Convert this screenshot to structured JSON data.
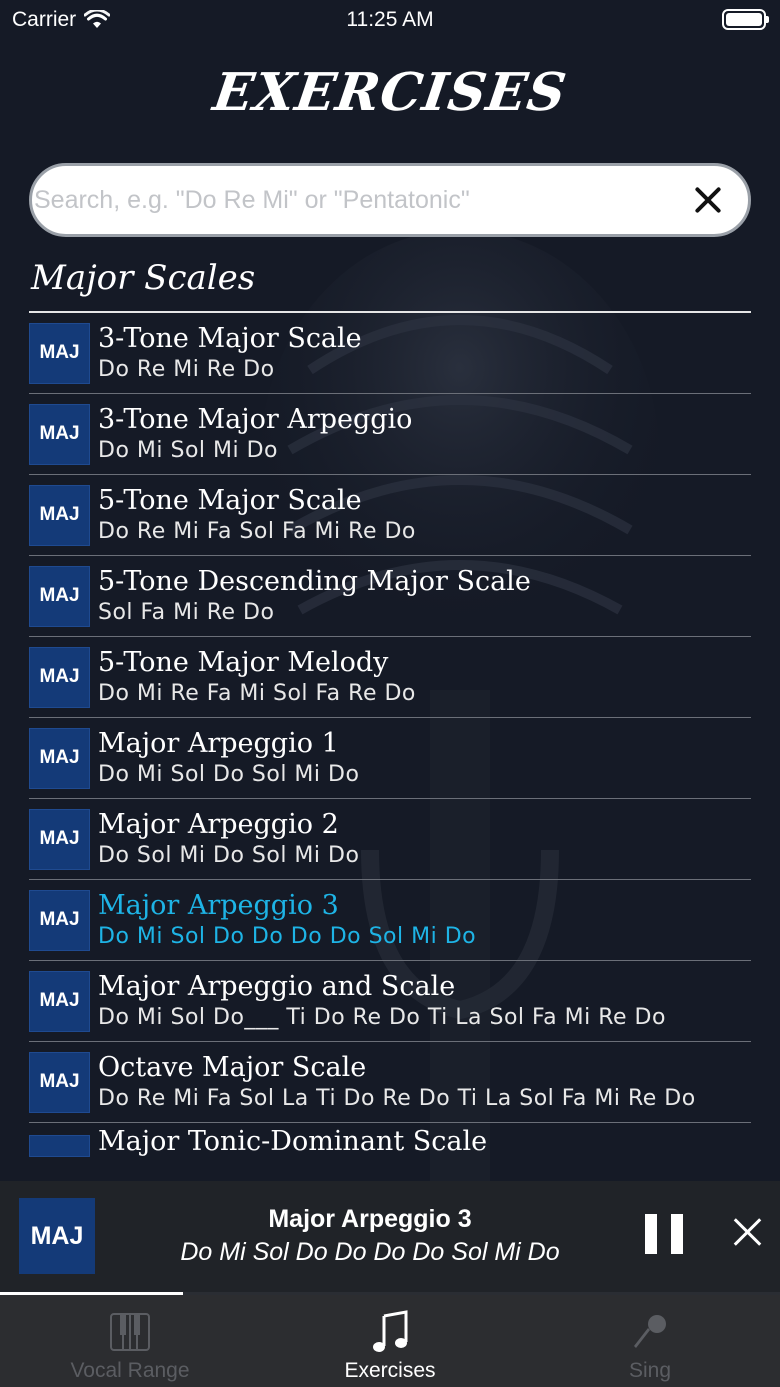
{
  "status_bar": {
    "carrier": "Carrier",
    "time": "11:25 AM"
  },
  "page_title": "Exercises",
  "search": {
    "value": "",
    "placeholder": "Search, e.g. \"Do Re Mi\" or \"Pentatonic\""
  },
  "section": {
    "title": "Major Scales"
  },
  "exercises": [
    {
      "badge": "MAJ",
      "title": "3-Tone Major Scale",
      "notes": "Do Re Mi Re Do"
    },
    {
      "badge": "MAJ",
      "title": "3-Tone Major Arpeggio",
      "notes": "Do Mi Sol Mi Do"
    },
    {
      "badge": "MAJ",
      "title": "5-Tone Major Scale",
      "notes": "Do Re Mi Fa Sol Fa Mi Re Do"
    },
    {
      "badge": "MAJ",
      "title": "5-Tone Descending Major Scale",
      "notes": "Sol Fa Mi Re Do"
    },
    {
      "badge": "MAJ",
      "title": "5-Tone Major Melody",
      "notes": "Do Mi Re Fa Mi Sol Fa Re Do"
    },
    {
      "badge": "MAJ",
      "title": "Major Arpeggio 1",
      "notes": "Do Mi Sol Do Sol Mi Do"
    },
    {
      "badge": "MAJ",
      "title": "Major Arpeggio 2",
      "notes": "Do Sol Mi Do Sol Mi Do"
    },
    {
      "badge": "MAJ",
      "title": "Major Arpeggio 3",
      "notes": "Do Mi Sol Do Do Do Do Sol Mi Do"
    },
    {
      "badge": "MAJ",
      "title": "Major Arpeggio and Scale",
      "notes": "Do Mi Sol Do___ Ti Do Re Do Ti La Sol Fa Mi Re Do"
    },
    {
      "badge": "MAJ",
      "title": "Octave Major Scale",
      "notes": "Do Re Mi Fa Sol La Ti Do Re Do Ti La Sol Fa Mi Re Do"
    },
    {
      "badge": "",
      "title": "Major Tonic-Dominant Scale",
      "notes": ""
    }
  ],
  "now_playing": {
    "badge": "MAJ",
    "title": "Major Arpeggio 3",
    "notes": "Do Mi Sol Do Do Do Do Sol Mi Do",
    "progress": 0.235
  },
  "tabs": [
    {
      "label": "Vocal Range",
      "icon": "piano-icon"
    },
    {
      "label": "Exercises",
      "icon": "music-note-icon"
    },
    {
      "label": "Sing",
      "icon": "microphone-icon"
    }
  ],
  "colors": {
    "background": "#151a26",
    "badge": "#143a78",
    "active": "#1eb4e6"
  }
}
